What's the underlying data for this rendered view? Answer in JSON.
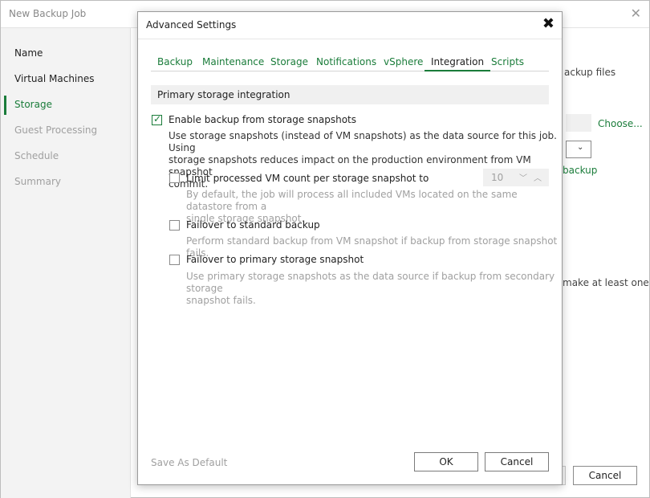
{
  "background": {
    "window_title": "New Backup Job",
    "close_glyph": "✕",
    "nav": [
      {
        "label": "Name",
        "state": "done"
      },
      {
        "label": "Virtual Machines",
        "state": "done"
      },
      {
        "label": "Storage",
        "state": "active"
      },
      {
        "label": "Guest Processing",
        "state": "muted"
      },
      {
        "label": "Schedule",
        "state": "muted"
      },
      {
        "label": "Summary",
        "state": "muted"
      }
    ],
    "partial_text_backup_files": "ackup files",
    "choose_link": "Choose...",
    "partial_link_backup": "backup",
    "partial_text_make_at_least": "make at least one",
    "cancel_button": "Cancel"
  },
  "dialog": {
    "title": "Advanced Settings",
    "close_glyph": "✖",
    "tabs": [
      {
        "label": "Backup",
        "active": false
      },
      {
        "label": "Maintenance",
        "active": false
      },
      {
        "label": "Storage",
        "active": false
      },
      {
        "label": "Notifications",
        "active": false
      },
      {
        "label": "vSphere",
        "active": false
      },
      {
        "label": "Integration",
        "active": true
      },
      {
        "label": "Scripts",
        "active": false
      }
    ],
    "section_title": "Primary storage integration",
    "enable_backup": {
      "label": "Enable backup from storage snapshots",
      "checked": true,
      "description_lines": [
        "Use storage snapshots (instead of VM snapshots) as the data source for this job. Using",
        "storage snapshots reduces impact on the production environment from VM snapshot",
        "commit."
      ]
    },
    "limit_vm": {
      "label": "Limit processed VM count per storage snapshot to",
      "checked": false,
      "description_lines": [
        "By default, the job will process all included VMs located on the same datastore from a",
        "single storage snapshot."
      ],
      "stepper_value": "10"
    },
    "failover_standard": {
      "label": "Failover to standard backup",
      "checked": false,
      "description_lines": [
        "Perform standard backup from VM snapshot if backup from storage snapshot fails."
      ]
    },
    "failover_primary": {
      "label": "Failover to primary storage snapshot",
      "checked": false,
      "description_lines": [
        "Use primary storage snapshots as the data source if backup from secondary storage",
        "snapshot fails."
      ]
    },
    "save_as_default": "Save As Default",
    "ok_button": "OK",
    "cancel_button": "Cancel"
  },
  "icons": {
    "checkmark": "check-icon",
    "stepper_down": "chevron-down-icon",
    "stepper_up": "chevron-up-icon",
    "select_arrow": "chevron-down-icon"
  },
  "colors": {
    "accent_green": "#1a7c3a",
    "sidebar_bg": "#f3f3f3",
    "section_header_bg": "#f0f0f0",
    "disabled_text": "#a0a0a0"
  }
}
